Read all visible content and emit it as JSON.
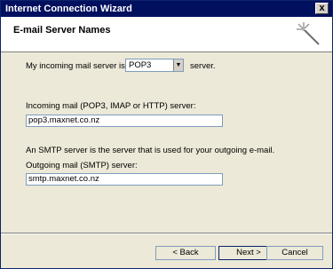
{
  "window": {
    "title": "Internet Connection Wizard",
    "close_label": "x"
  },
  "header": {
    "title": "E-mail Server Names",
    "icon": "wizard-sparkle-icon"
  },
  "incoming": {
    "prefix": "My incoming mail server is a",
    "server_type": "POP3",
    "suffix": "server."
  },
  "incoming_server": {
    "label": "Incoming mail (POP3, IMAP or HTTP) server:",
    "value": "pop3.maxnet.co.nz"
  },
  "smtp": {
    "description": "An SMTP server is the server that is used for your outgoing e-mail.",
    "label": "Outgoing mail (SMTP) server:",
    "value": "smtp.maxnet.co.nz"
  },
  "buttons": {
    "back": "< Back",
    "next": "Next >",
    "cancel": "Cancel"
  }
}
